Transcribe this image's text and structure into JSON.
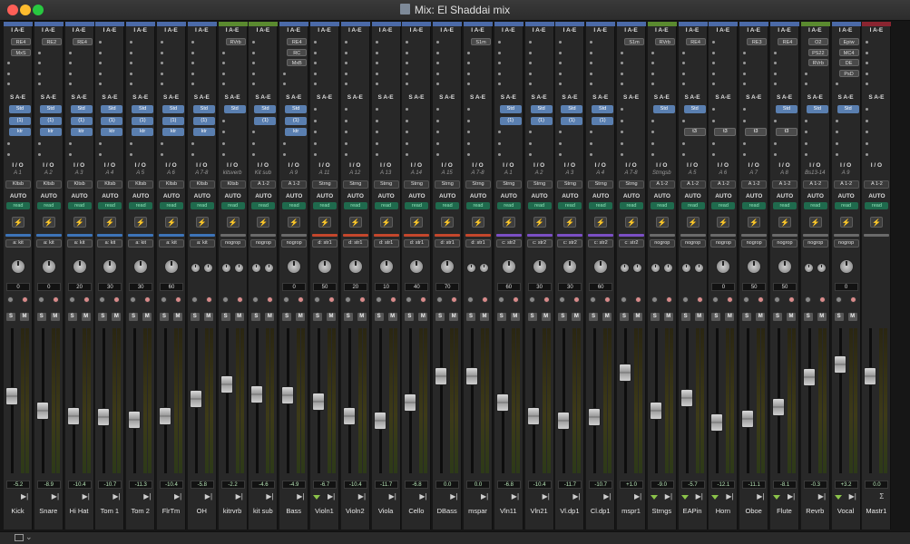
{
  "window": {
    "title": "Mix: El Shaddai mix"
  },
  "sections": {
    "inserts_header": "I A-E",
    "sends_header": "S A-E",
    "io_header": "I / O",
    "auto_header": "AUTO"
  },
  "strips": [
    {
      "name": "Kick",
      "color": "#4b6aa8",
      "inserts": [
        "RE4",
        "MxS"
      ],
      "sends": [
        "Std",
        "(1)",
        "ktr"
      ],
      "input": "A 1",
      "output": "Kltsb",
      "auto": "AUTO",
      "automode": "read",
      "group": "a: kit",
      "grpcolor": "#3d74b8",
      "pan": "0",
      "vol": "-5.2"
    },
    {
      "name": "Snare",
      "color": "#4b6aa8",
      "inserts": [
        "RE2"
      ],
      "sends": [
        "Std",
        "(1)",
        "ktr"
      ],
      "input": "A 2",
      "output": "Kltsb",
      "auto": "AUTO",
      "automode": "read",
      "group": "a: kit",
      "grpcolor": "#3d74b8",
      "pan": "0",
      "vol": "-8.9"
    },
    {
      "name": "Hi Hat",
      "color": "#4b6aa8",
      "inserts": [
        "RE4"
      ],
      "sends": [
        "Std",
        "(1)",
        "ktr"
      ],
      "input": "A 3",
      "output": "Kltsb",
      "auto": "AUTO",
      "automode": "read",
      "group": "a: kit",
      "grpcolor": "#3d74b8",
      "pan": "20",
      "vol": "-10.4"
    },
    {
      "name": "Tom 1",
      "color": "#4b6aa8",
      "inserts": [],
      "sends": [
        "Std",
        "(1)",
        "ktr"
      ],
      "input": "A 4",
      "output": "Kltsb",
      "auto": "AUTO",
      "automode": "read",
      "group": "a: kit",
      "grpcolor": "#3d74b8",
      "pan": "30",
      "vol": "-10.7"
    },
    {
      "name": "Tom 2",
      "color": "#4b6aa8",
      "inserts": [],
      "sends": [
        "Std",
        "(1)",
        "ktr"
      ],
      "input": "A 5",
      "output": "Kltsb",
      "auto": "AUTO",
      "automode": "read",
      "group": "a: kit",
      "grpcolor": "#3d74b8",
      "pan": "30",
      "vol": "-11.3"
    },
    {
      "name": "FlrTm",
      "color": "#4b6aa8",
      "inserts": [],
      "sends": [
        "Std",
        "(1)",
        "ktr"
      ],
      "input": "A 6",
      "output": "Kltsb",
      "auto": "AUTO",
      "automode": "read",
      "group": "a: kit",
      "grpcolor": "#3d74b8",
      "pan": "60",
      "vol": "-10.4"
    },
    {
      "name": "OH",
      "color": "#4b6aa8",
      "inserts": [],
      "sends": [
        "Std",
        "(1)",
        "ktr"
      ],
      "input": "A 7-8",
      "output": "Kltsb",
      "auto": "AUTO",
      "automode": "read",
      "group": "a: kit",
      "grpcolor": "#3d74b8",
      "pan": "",
      "vol": "-5.8"
    },
    {
      "name": "kitrvrb",
      "color": "#5a8a2f",
      "inserts": [
        "RVrb"
      ],
      "sends": [
        "Std"
      ],
      "input": "kitsverb",
      "output": "Kltsb",
      "auto": "AUTO",
      "automode": "read",
      "group": "nogrop",
      "grpcolor": "#6a6a6a",
      "pan": "",
      "vol": "-2.2"
    },
    {
      "name": "kit sub",
      "color": "#5a8a2f",
      "inserts": [],
      "sends": [
        "Std",
        "(1)"
      ],
      "input": "Kit sub",
      "output": "A 1-2",
      "auto": "AUTO",
      "automode": "read",
      "group": "nogrop",
      "grpcolor": "#6a6a6a",
      "pan": "",
      "vol": "-4.6"
    },
    {
      "name": "Bass",
      "color": "#4b6aa8",
      "inserts": [
        "RE4",
        "RC",
        "MxB"
      ],
      "sends": [
        "Std",
        "(1)",
        "ktr"
      ],
      "input": "A 9",
      "output": "A 1-2",
      "auto": "AUTO",
      "automode": "read",
      "group": "nogrop",
      "grpcolor": "#6a6a6a",
      "pan": "0",
      "vol": "-4.9"
    },
    {
      "name": "Violn1",
      "color": "#4b6aa8",
      "inserts": [],
      "sends": [],
      "input": "A 11",
      "output": "Strng",
      "auto": "AUTO",
      "automode": "read",
      "group": "d: str1",
      "grpcolor": "#c4472c",
      "pan": "50",
      "vol": "-6.7"
    },
    {
      "name": "Violn2",
      "color": "#4b6aa8",
      "inserts": [],
      "sends": [],
      "input": "A 12",
      "output": "Strng",
      "auto": "AUTO",
      "automode": "read",
      "group": "d: str1",
      "grpcolor": "#c4472c",
      "pan": "20",
      "vol": "-10.4"
    },
    {
      "name": "Viola",
      "color": "#4b6aa8",
      "inserts": [],
      "sends": [],
      "input": "A 13",
      "output": "Strng",
      "auto": "AUTO",
      "automode": "read",
      "group": "d: str1",
      "grpcolor": "#c4472c",
      "pan": "10",
      "vol": "-11.7"
    },
    {
      "name": "Cello",
      "color": "#4b6aa8",
      "inserts": [],
      "sends": [],
      "input": "A 14",
      "output": "Strng",
      "auto": "AUTO",
      "automode": "read",
      "group": "d: str1",
      "grpcolor": "#c4472c",
      "pan": "40",
      "vol": "-6.8"
    },
    {
      "name": "DBass",
      "color": "#4b6aa8",
      "inserts": [],
      "sends": [],
      "input": "A 15",
      "output": "Strng",
      "auto": "AUTO",
      "automode": "read",
      "group": "d: str1",
      "grpcolor": "#c4472c",
      "pan": "70",
      "vol": "0.0"
    },
    {
      "name": "mspar",
      "color": "#4b6aa8",
      "inserts": [
        "S1m"
      ],
      "sends": [],
      "input": "A 7-8",
      "output": "Strng",
      "auto": "AUTO",
      "automode": "read",
      "group": "d: str1",
      "grpcolor": "#c4472c",
      "pan": "",
      "vol": "0.0"
    },
    {
      "name": "Vln11",
      "color": "#4b6aa8",
      "inserts": [],
      "sends": [
        "Std",
        "(1)"
      ],
      "input": "A 1",
      "output": "Strng",
      "auto": "AUTO",
      "automode": "read",
      "group": "c: str2",
      "grpcolor": "#7b4fc4",
      "pan": "60",
      "vol": "-6.8"
    },
    {
      "name": "Vln21",
      "color": "#4b6aa8",
      "inserts": [],
      "sends": [
        "Std",
        "(1)"
      ],
      "input": "A 2",
      "output": "Strng",
      "auto": "AUTO",
      "automode": "read",
      "group": "c: str2",
      "grpcolor": "#7b4fc4",
      "pan": "30",
      "vol": "-10.4"
    },
    {
      "name": "Vl.dp1",
      "color": "#4b6aa8",
      "inserts": [],
      "sends": [
        "Std",
        "(1)"
      ],
      "input": "A 3",
      "output": "Strng",
      "auto": "AUTO",
      "automode": "read",
      "group": "c: str2",
      "grpcolor": "#7b4fc4",
      "pan": "30",
      "vol": "-11.7"
    },
    {
      "name": "Cl.dp1",
      "color": "#4b6aa8",
      "inserts": [],
      "sends": [
        "Std",
        "(1)"
      ],
      "input": "A 4",
      "output": "Strng",
      "auto": "AUTO",
      "automode": "read",
      "group": "c: str2",
      "grpcolor": "#7b4fc4",
      "pan": "60",
      "vol": "-10.7"
    },
    {
      "name": "mspr1",
      "color": "#4b6aa8",
      "inserts": [
        "S1m"
      ],
      "sends": [],
      "input": "A 7-8",
      "output": "Strng",
      "auto": "AUTO",
      "automode": "read",
      "group": "c: str2",
      "grpcolor": "#7b4fc4",
      "pan": "",
      "vol": "+1.0"
    },
    {
      "name": "Strngs",
      "color": "#5a8a2f",
      "inserts": [
        "RVrb"
      ],
      "sends": [
        "Std"
      ],
      "input": "Strngsb",
      "output": "A 1-2",
      "auto": "AUTO",
      "automode": "read",
      "group": "nogrop",
      "grpcolor": "#6a6a6a",
      "pan": "",
      "vol": "-9.0"
    },
    {
      "name": "EAPin",
      "color": "#4b6aa8",
      "inserts": [
        "RE4"
      ],
      "sends": [
        "Std",
        "",
        "t3"
      ],
      "input": "A 5",
      "output": "A 1-2",
      "auto": "AUTO",
      "automode": "read",
      "group": "nogrop",
      "grpcolor": "#6a6a6a",
      "pan": "",
      "vol": "-5.7"
    },
    {
      "name": "Horn",
      "color": "#4b6aa8",
      "inserts": [],
      "sends": [
        "",
        "",
        "t3"
      ],
      "input": "A 6",
      "output": "A 1-2",
      "auto": "AUTO",
      "automode": "read",
      "group": "nogrop",
      "grpcolor": "#6a6a6a",
      "pan": "0",
      "vol": "-12.1"
    },
    {
      "name": "Oboe",
      "color": "#4b6aa8",
      "inserts": [
        "RE3"
      ],
      "sends": [
        "",
        "",
        "t3"
      ],
      "input": "A 7",
      "output": "A 1-2",
      "auto": "AUTO",
      "automode": "read",
      "group": "nogrop",
      "grpcolor": "#6a6a6a",
      "pan": "50",
      "vol": "-11.1"
    },
    {
      "name": "Flute",
      "color": "#4b6aa8",
      "inserts": [
        "RE4"
      ],
      "sends": [
        "Std",
        "",
        "t3"
      ],
      "input": "A 8",
      "output": "A 1-2",
      "auto": "AUTO",
      "automode": "read",
      "group": "nogrop",
      "grpcolor": "#6a6a6a",
      "pan": "50",
      "vol": "-8.1"
    },
    {
      "name": "Revrb",
      "color": "#5a8a2f",
      "inserts": [
        "O2",
        "PS22",
        "RVrb"
      ],
      "sends": [
        "Std"
      ],
      "input": "Bs13-14",
      "output": "A 1-2",
      "auto": "AUTO",
      "automode": "read",
      "group": "nogrop",
      "grpcolor": "#6a6a6a",
      "pan": "",
      "vol": "-0.3"
    },
    {
      "name": "Vocal",
      "color": "#4b6aa8",
      "inserts": [
        "Epiw",
        "MC4",
        "DE",
        "PsD"
      ],
      "sends": [
        "Std"
      ],
      "input": "A 9",
      "output": "A 1-2",
      "auto": "AUTO",
      "automode": "read",
      "group": "nogrop",
      "grpcolor": "#6a6a6a",
      "pan": "0",
      "vol": "+3.2"
    },
    {
      "name": "Mastr1",
      "color": "#8a2430",
      "inserts": [],
      "sends": [],
      "input": "",
      "output": "A 1-2",
      "auto": "AUTO",
      "automode": "read",
      "group": "",
      "grpcolor": "#6a6a6a",
      "pan": "",
      "vol": "0.0"
    }
  ]
}
